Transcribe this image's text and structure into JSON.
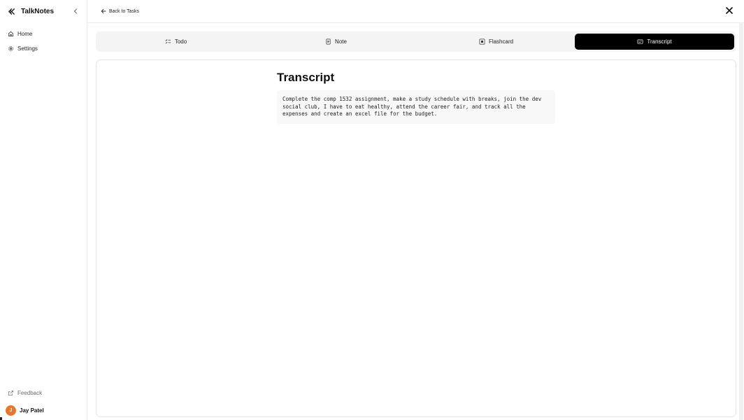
{
  "sidebar": {
    "app_name": "TalkNotes",
    "items": [
      {
        "label": "Home",
        "icon": "home-icon"
      },
      {
        "label": "Settings",
        "icon": "gear-icon"
      }
    ],
    "feedback_label": "Feedback",
    "user": {
      "initial": "J",
      "name": "Jay Patel",
      "avatar_color": "#e8772e"
    }
  },
  "header": {
    "back_label": "Back to Tasks"
  },
  "tabs": [
    {
      "label": "Todo",
      "icon": "checklist-icon",
      "active": false
    },
    {
      "label": "Note",
      "icon": "note-icon",
      "active": false
    },
    {
      "label": "Flashcard",
      "icon": "flashcard-icon",
      "active": false
    },
    {
      "label": "Transcript",
      "icon": "transcript-icon",
      "active": true
    }
  ],
  "content": {
    "title": "Transcript",
    "text": "Complete the comp 1532 assignment, make a study schedule with breaks, join the dev social club, I have to eat healthy, attend the career fair, and track all the expenses and create an excel file for the budget."
  },
  "colors": {
    "active_tab_bg": "#000000",
    "active_tab_text": "#ffffff",
    "tab_bar_bg": "#f4f4f4",
    "avatar": "#e8772e"
  }
}
